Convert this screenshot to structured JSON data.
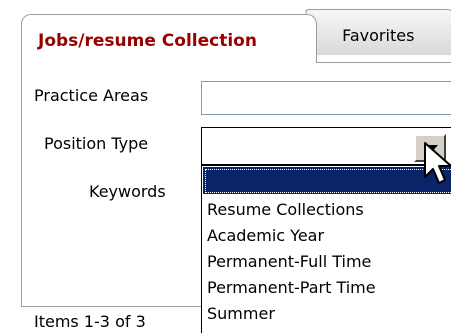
{
  "tabs": {
    "active_label": "Jobs/resume Collection",
    "inactive_label": "Favorites"
  },
  "form": {
    "practice_areas_label": "Practice Areas",
    "practice_areas_value": "",
    "position_type_label": "Position Type",
    "position_type_value": "",
    "keywords_label": "Keywords"
  },
  "dropdown": {
    "open": true,
    "selected_index": 0,
    "options": [
      "",
      "Resume Collections",
      "Academic Year",
      "Permanent-Full Time",
      "Permanent-Part Time",
      "Summer"
    ]
  },
  "footer": {
    "items_text": "Items 1-3 of 3"
  },
  "colors": {
    "active_tab_text": "#990000",
    "selection_highlight": "#0a246a",
    "panel_border": "#9c9c9c",
    "input_border": "#7f9db9"
  },
  "icons": {
    "dropdown_arrow": "chevron-down-icon",
    "cursor": "mouse-pointer-icon"
  }
}
